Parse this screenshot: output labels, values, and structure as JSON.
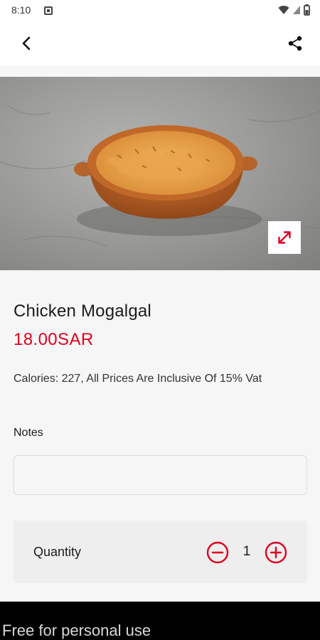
{
  "status_bar": {
    "time": "8:10",
    "icons": [
      "notification-icon",
      "wifi-icon",
      "signal-icon",
      "battery-icon"
    ]
  },
  "app_bar": {
    "back_icon": "back-arrow-icon",
    "share_icon": "share-icon"
  },
  "hero": {
    "image": "orange clay bowl of shredded chicken on grey concrete",
    "expand_icon": "expand-icon"
  },
  "product": {
    "name": "Chicken Mogalgal",
    "price": "18.00SAR",
    "description": "Calories: 227, All Prices Are Inclusive Of 15% Vat"
  },
  "notes": {
    "label": "Notes",
    "value": "",
    "placeholder": ""
  },
  "quantity": {
    "label": "Quantity",
    "value": "1",
    "minus_icon": "minus-circle-icon",
    "plus_icon": "plus-circle-icon"
  },
  "footer": {
    "watermark": "Free for personal use"
  },
  "colors": {
    "accent": "#e1001f",
    "background": "#f6f6f6",
    "card": "#eeeeee"
  }
}
